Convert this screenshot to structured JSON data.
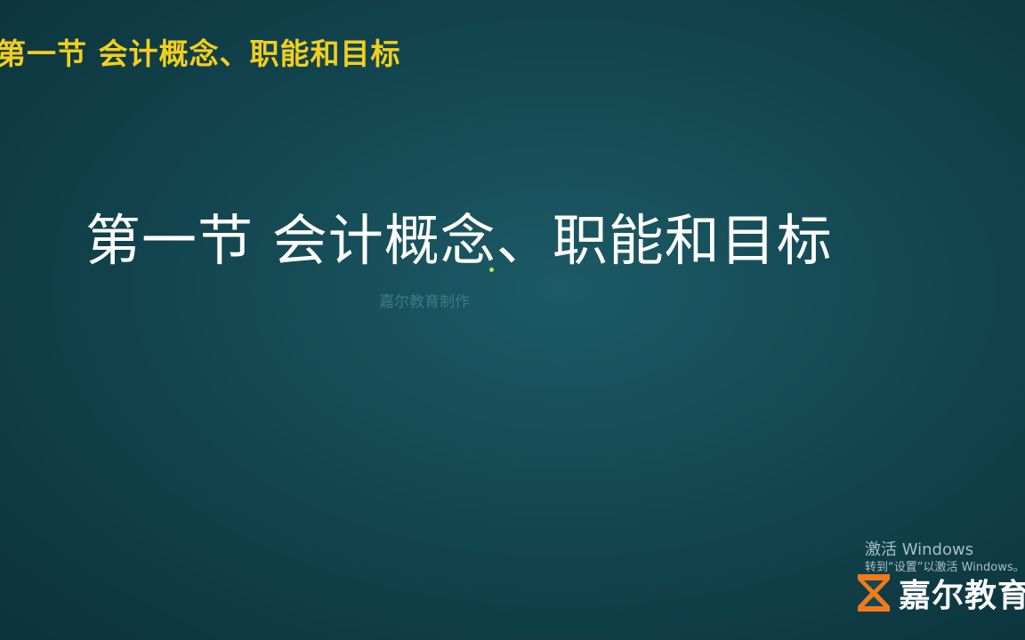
{
  "slide": {
    "header_title": "第一节  会计概念、职能和目标",
    "main_title": "第一节  会计概念、职能和目标",
    "subtitle": "嘉尔教育制作"
  },
  "windows_activation": {
    "title": "激活 Windows",
    "message": "转到“设置”以激活 Windows。"
  },
  "logo": {
    "icon": "hourglass-logo-icon",
    "text": "嘉尔教育"
  },
  "colors": {
    "background": "#134751",
    "header_title": "#f2cf1e",
    "main_title": "#ffffff",
    "subtitle": "#3d7a84",
    "logo_icon": "#f07a1c"
  }
}
